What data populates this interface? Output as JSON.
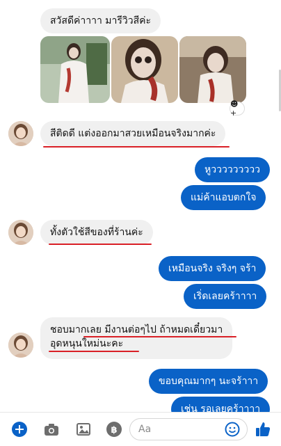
{
  "messages": {
    "m1": "สวัสดีค่าาาา มารีวิวสีค่ะ",
    "m2": "สีติดดี แต่งออกมาสวยเหมือนจริงมากค่ะ",
    "m3": "หูววววววววว",
    "m4": "แม่ค้าแอบตกใจ",
    "m5": "ทั้งตัวใช้สีของที่ร้านค่ะ",
    "m6": "เหมือนจริง จริงๆ จร้า",
    "m7": "เริ่ดเลยคร้าาาา",
    "m8_line1": "ชอบมากเลย มีงานต่อๆไป ถ้าหมดเดี๋ยวมา",
    "m8_line2": "อุดหนุนใหม่นะคะ",
    "m9": "ขอบคุณมากๆ นะจร้าาา",
    "m10": "เช่น รอเลยคร้าาาา"
  },
  "reaction": {
    "icon": "smile-add-icon",
    "label": "☻+"
  },
  "composer": {
    "placeholder": "Aa"
  },
  "icons": {
    "add": "plus-circle-icon",
    "camera": "camera-icon",
    "gallery": "image-icon",
    "payment": "baht-coin-icon",
    "emoji": "smiley-icon",
    "like": "thumbs-up-icon"
  },
  "colors": {
    "accent": "#0a62c7",
    "underline": "#d91f26",
    "incoming": "#f0f0f0"
  }
}
